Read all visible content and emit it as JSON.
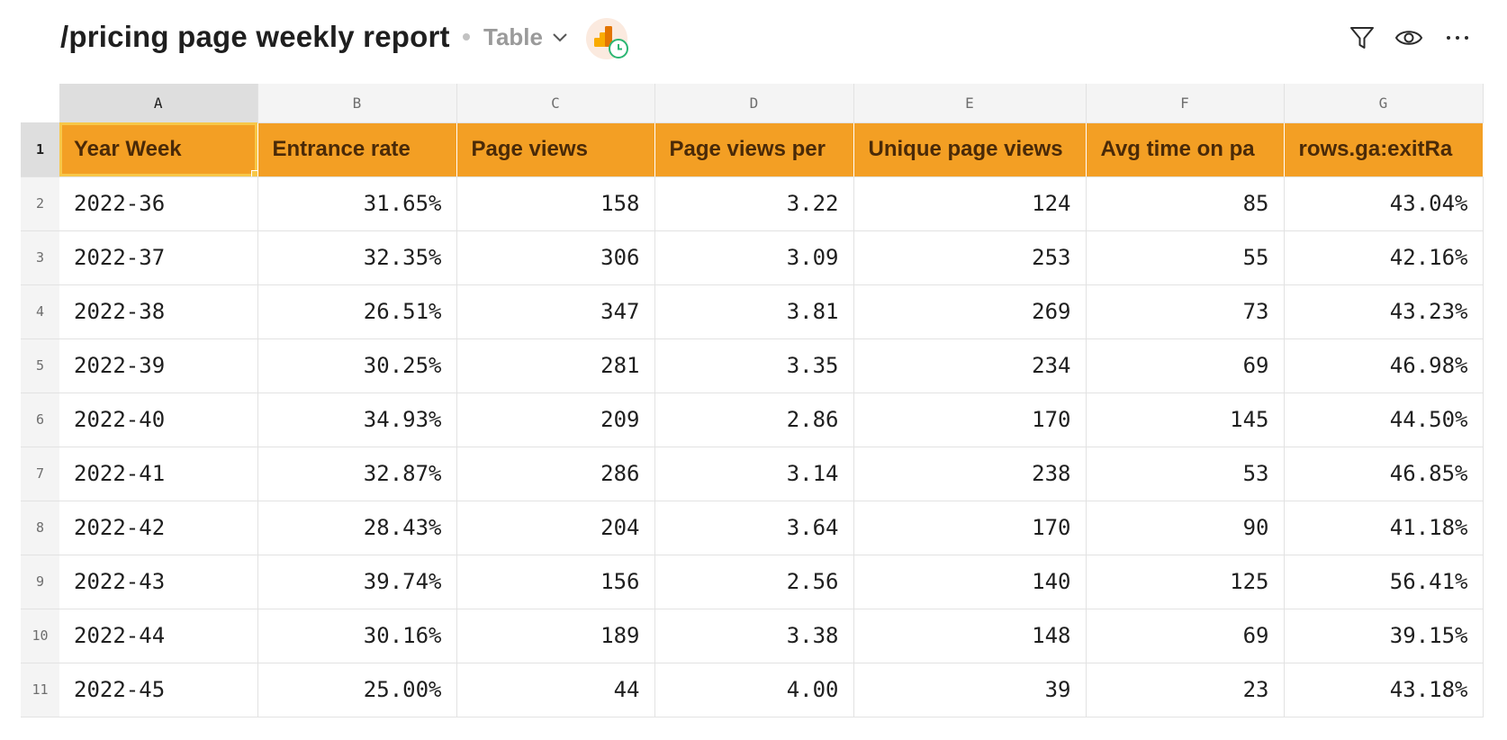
{
  "header": {
    "title": "/pricing page weekly report",
    "view_label": "Table"
  },
  "icons": {
    "view_chevron": "chevron-down-icon",
    "app_badge": "google-analytics-icon",
    "filter": "filter-icon",
    "visibility": "eye-icon",
    "more": "more-horizontal-icon"
  },
  "colors": {
    "accent": "#f39f24",
    "selection": "#f7c748",
    "schedule_badge": "#2bb673"
  },
  "columns": [
    "A",
    "B",
    "C",
    "D",
    "E",
    "F",
    "G"
  ],
  "table": {
    "headers": [
      "Year Week",
      "Entrance rate",
      "Page views",
      "Page views per",
      "Unique page views",
      "Avg time on pa",
      "rows.ga:exitRa"
    ],
    "rows": [
      [
        "2022-36",
        "31.65%",
        "158",
        "3.22",
        "124",
        "85",
        "43.04%"
      ],
      [
        "2022-37",
        "32.35%",
        "306",
        "3.09",
        "253",
        "55",
        "42.16%"
      ],
      [
        "2022-38",
        "26.51%",
        "347",
        "3.81",
        "269",
        "73",
        "43.23%"
      ],
      [
        "2022-39",
        "30.25%",
        "281",
        "3.35",
        "234",
        "69",
        "46.98%"
      ],
      [
        "2022-40",
        "34.93%",
        "209",
        "2.86",
        "170",
        "145",
        "44.50%"
      ],
      [
        "2022-41",
        "32.87%",
        "286",
        "3.14",
        "238",
        "53",
        "46.85%"
      ],
      [
        "2022-42",
        "28.43%",
        "204",
        "3.64",
        "170",
        "90",
        "41.18%"
      ],
      [
        "2022-43",
        "39.74%",
        "156",
        "2.56",
        "140",
        "125",
        "56.41%"
      ],
      [
        "2022-44",
        "30.16%",
        "189",
        "3.38",
        "148",
        "69",
        "39.15%"
      ],
      [
        "2022-45",
        "25.00%",
        "44",
        "4.00",
        "39",
        "23",
        "43.18%"
      ]
    ]
  },
  "selection": {
    "cell": "A1"
  }
}
